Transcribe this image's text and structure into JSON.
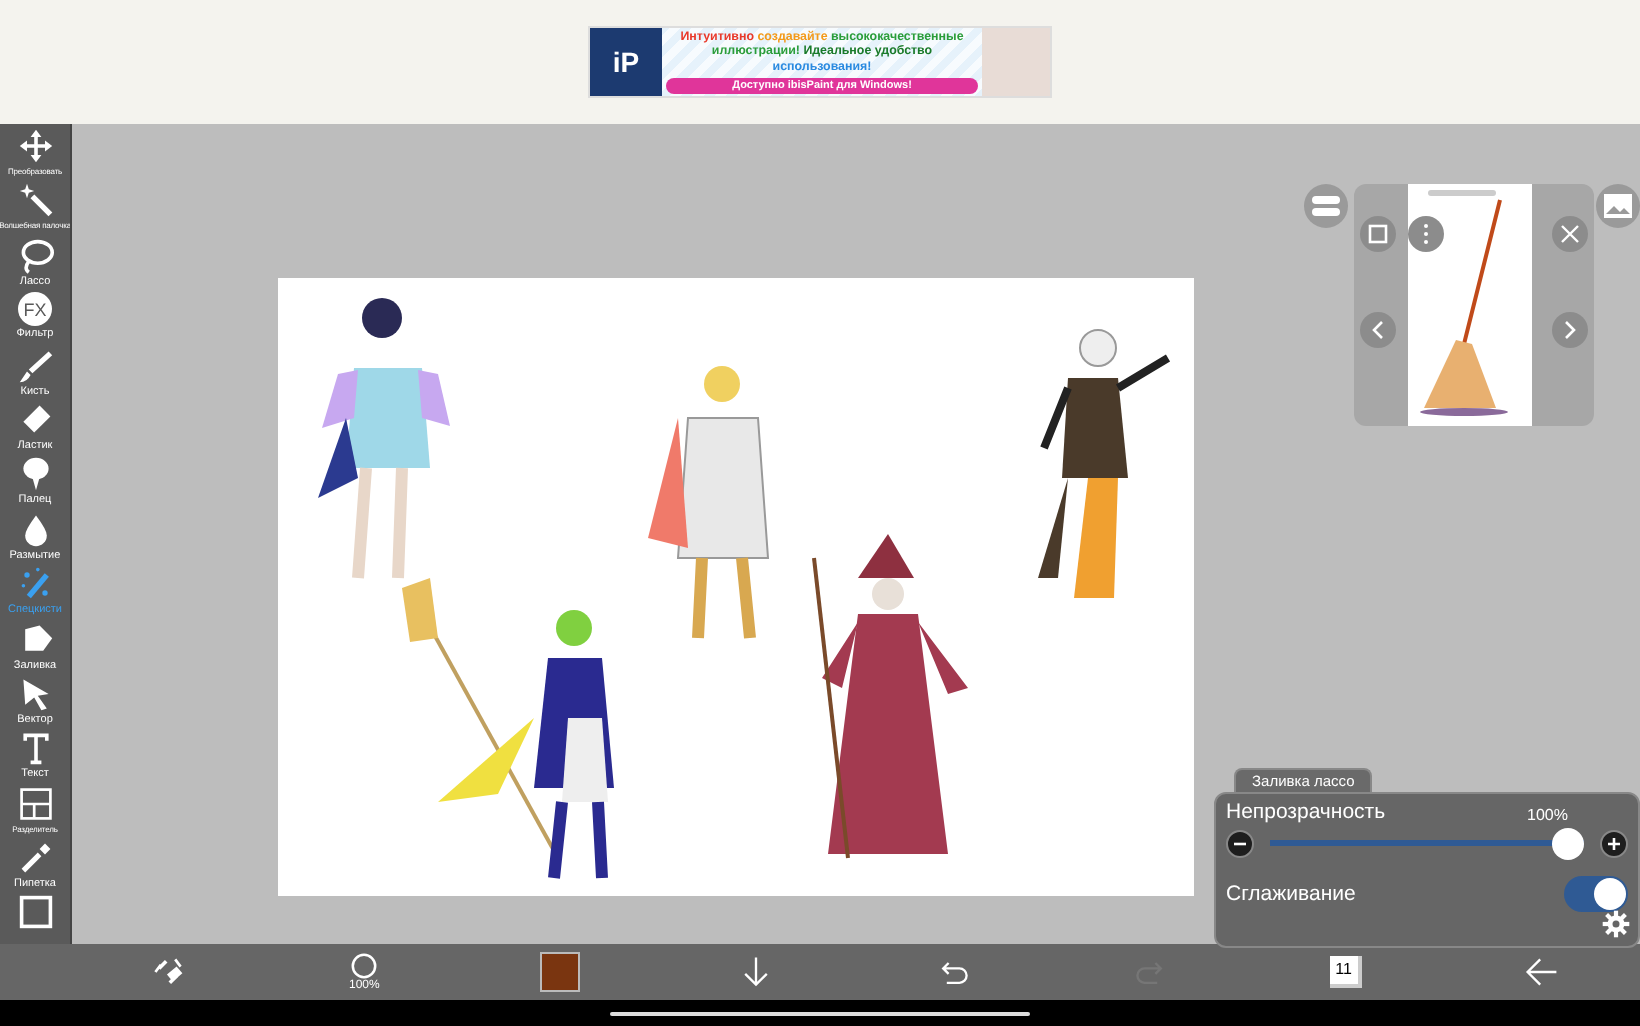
{
  "ad_banner": {
    "logo_text": "iP",
    "headline_parts": [
      {
        "text": "Интуитивно ",
        "color": "#e8392b"
      },
      {
        "text": "создавайте ",
        "color": "#f39a1a"
      },
      {
        "text": "высококачественные иллюстрации! ",
        "color": "#2a9d3a"
      },
      {
        "text": "Идеальное удобство ",
        "color": "#1a7a2a"
      },
      {
        "text": "использования!",
        "color": "#2a8ae0"
      }
    ],
    "cta": "Доступно ibisPaint для Windows!"
  },
  "toolbar": [
    {
      "kind": "transform",
      "label": "Преобразовать",
      "selected": false
    },
    {
      "kind": "magic-wand",
      "label": "Волшебная палочка",
      "selected": false
    },
    {
      "kind": "lasso",
      "label": "Лассо",
      "selected": false
    },
    {
      "kind": "filter",
      "label": "Фильтр",
      "icon_text": "FX",
      "selected": false
    },
    {
      "kind": "brush",
      "label": "Кисть",
      "selected": false
    },
    {
      "kind": "eraser",
      "label": "Ластик",
      "selected": false
    },
    {
      "kind": "smudge",
      "label": "Палец",
      "selected": false
    },
    {
      "kind": "blur",
      "label": "Размытие",
      "selected": false
    },
    {
      "kind": "special",
      "label": "Спецкисти",
      "selected": true
    },
    {
      "kind": "fill",
      "label": "Заливка",
      "selected": false
    },
    {
      "kind": "vector",
      "label": "Вектор",
      "selected": false
    },
    {
      "kind": "text",
      "label": "Текст",
      "selected": false
    },
    {
      "kind": "divider",
      "label": "Разделитель",
      "selected": false
    },
    {
      "kind": "eyedropper",
      "label": "Пипетка",
      "selected": false
    },
    {
      "kind": "frame",
      "selected": false
    }
  ],
  "lasso_fill_panel": {
    "tab": "Заливка лассо",
    "opacity_label": "Непрозрачность",
    "opacity_value": "100%",
    "level": 1,
    "antialias_label": "Сглаживание",
    "antialias_on": true
  },
  "bottom_bar": [
    {
      "kind": "transform",
      "disabled": false
    },
    {
      "kind": "brush-size",
      "label": "100%",
      "disabled": false
    },
    {
      "kind": "color",
      "color": "#7a3510",
      "disabled": false
    },
    {
      "kind": "download",
      "disabled": false
    },
    {
      "kind": "undo",
      "disabled": false
    },
    {
      "kind": "redo",
      "disabled": true
    },
    {
      "kind": "layers",
      "label": "11",
      "disabled": false
    },
    {
      "kind": "back",
      "disabled": false
    }
  ]
}
